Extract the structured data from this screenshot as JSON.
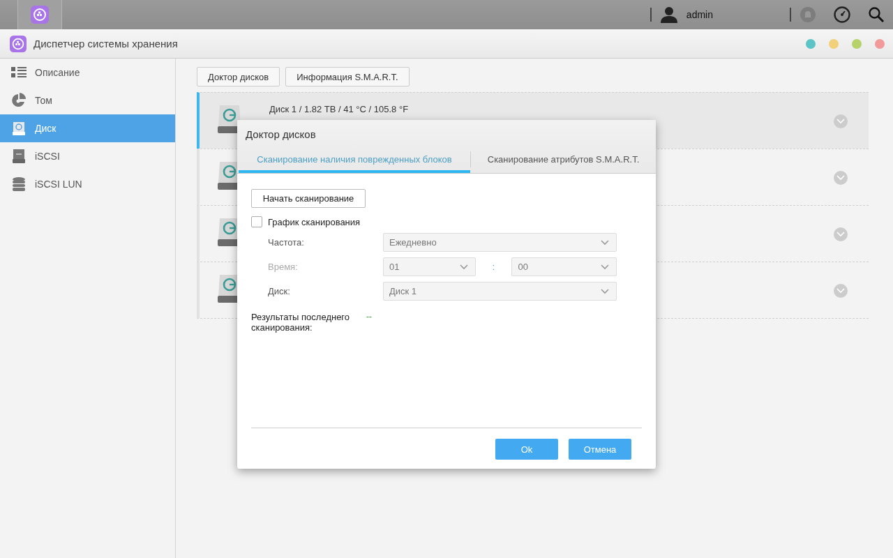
{
  "topbar": {
    "user": "admin"
  },
  "window": {
    "title": "Диспетчер системы хранения",
    "controls": [
      {
        "color": "#5bc4c6"
      },
      {
        "color": "#f2d07a"
      },
      {
        "color": "#b5d36a"
      },
      {
        "color": "#f29a9a"
      }
    ]
  },
  "sidebar": {
    "items": [
      {
        "label": "Описание",
        "kind": "list",
        "selected": false
      },
      {
        "label": "Том",
        "kind": "volume",
        "selected": false
      },
      {
        "label": "Диск",
        "kind": "disk",
        "selected": true
      },
      {
        "label": "iSCSI",
        "kind": "target",
        "selected": false
      },
      {
        "label": "iSCSI LUN",
        "kind": "lun",
        "selected": false
      }
    ]
  },
  "toolbar": {
    "buttons": [
      "Доктор дисков",
      "Информация S.M.A.R.T."
    ]
  },
  "disks": [
    {
      "title": "Диск 1 / 1.82 TB / 41 °C / 105.8 °F",
      "selected": true
    },
    {
      "selected": false
    },
    {
      "selected": false
    },
    {
      "selected": false
    }
  ],
  "dialog": {
    "title": "Доктор дисков",
    "tabs": [
      {
        "label": "Сканирование наличия поврежденных блоков",
        "selected": true
      },
      {
        "label": "Сканирование атрибутов S.M.A.R.T.",
        "selected": false
      }
    ],
    "start_button": "Начать сканирование",
    "schedule": {
      "label": "График сканирования",
      "checked": false
    },
    "fields": [
      {
        "kind": "select",
        "label": "Частота:",
        "value": "Ежедневно",
        "disabled": false
      },
      {
        "kind": "time",
        "label": "Время:",
        "hour": "01",
        "separator": ":",
        "minute": "00",
        "disabled": true
      },
      {
        "kind": "select",
        "label": "Диск:",
        "value": "Диск 1",
        "disabled": false
      }
    ],
    "results": {
      "label": "Результаты последнего сканирования:",
      "value": "--"
    },
    "buttons": [
      "Ok",
      "Отмена"
    ]
  }
}
